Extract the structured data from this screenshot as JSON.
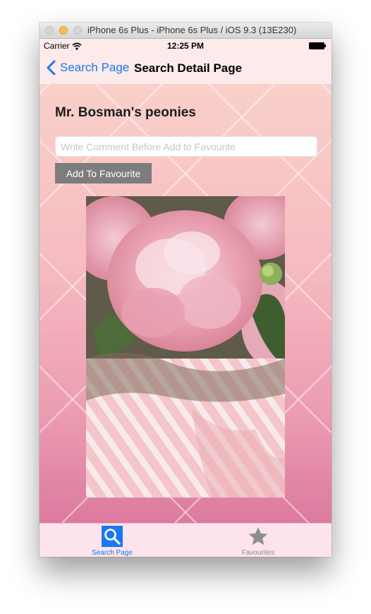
{
  "window": {
    "title": "iPhone 6s Plus - iPhone 6s Plus / iOS 9.3 (13E230)"
  },
  "status_bar": {
    "carrier": "Carrier",
    "time": "12:25 PM",
    "wifi_icon": "wifi-icon",
    "battery_icon": "battery-icon"
  },
  "nav_bar": {
    "back_label": "Search Page",
    "back_icon": "chevron-left-icon",
    "title": "Search Detail Page",
    "tint_color": "#1a78f2"
  },
  "detail": {
    "item_title": "Mr. Bosman's peonies",
    "comment_placeholder": "Write Comment Before Add to Favourite",
    "comment_value": "",
    "add_button_label": "Add To Favourite",
    "photo": "pink-peonies-photo"
  },
  "tab_bar": {
    "tabs": [
      {
        "label": "Search Page",
        "icon": "magnifier-icon",
        "selected": true
      },
      {
        "label": "Favourites",
        "icon": "star-icon",
        "selected": false
      }
    ]
  },
  "colors": {
    "accent": "#1a78f2",
    "button_bg": "#7d7d7d",
    "background_top": "#f9d0ca",
    "background_bottom": "#dc7a9f"
  }
}
